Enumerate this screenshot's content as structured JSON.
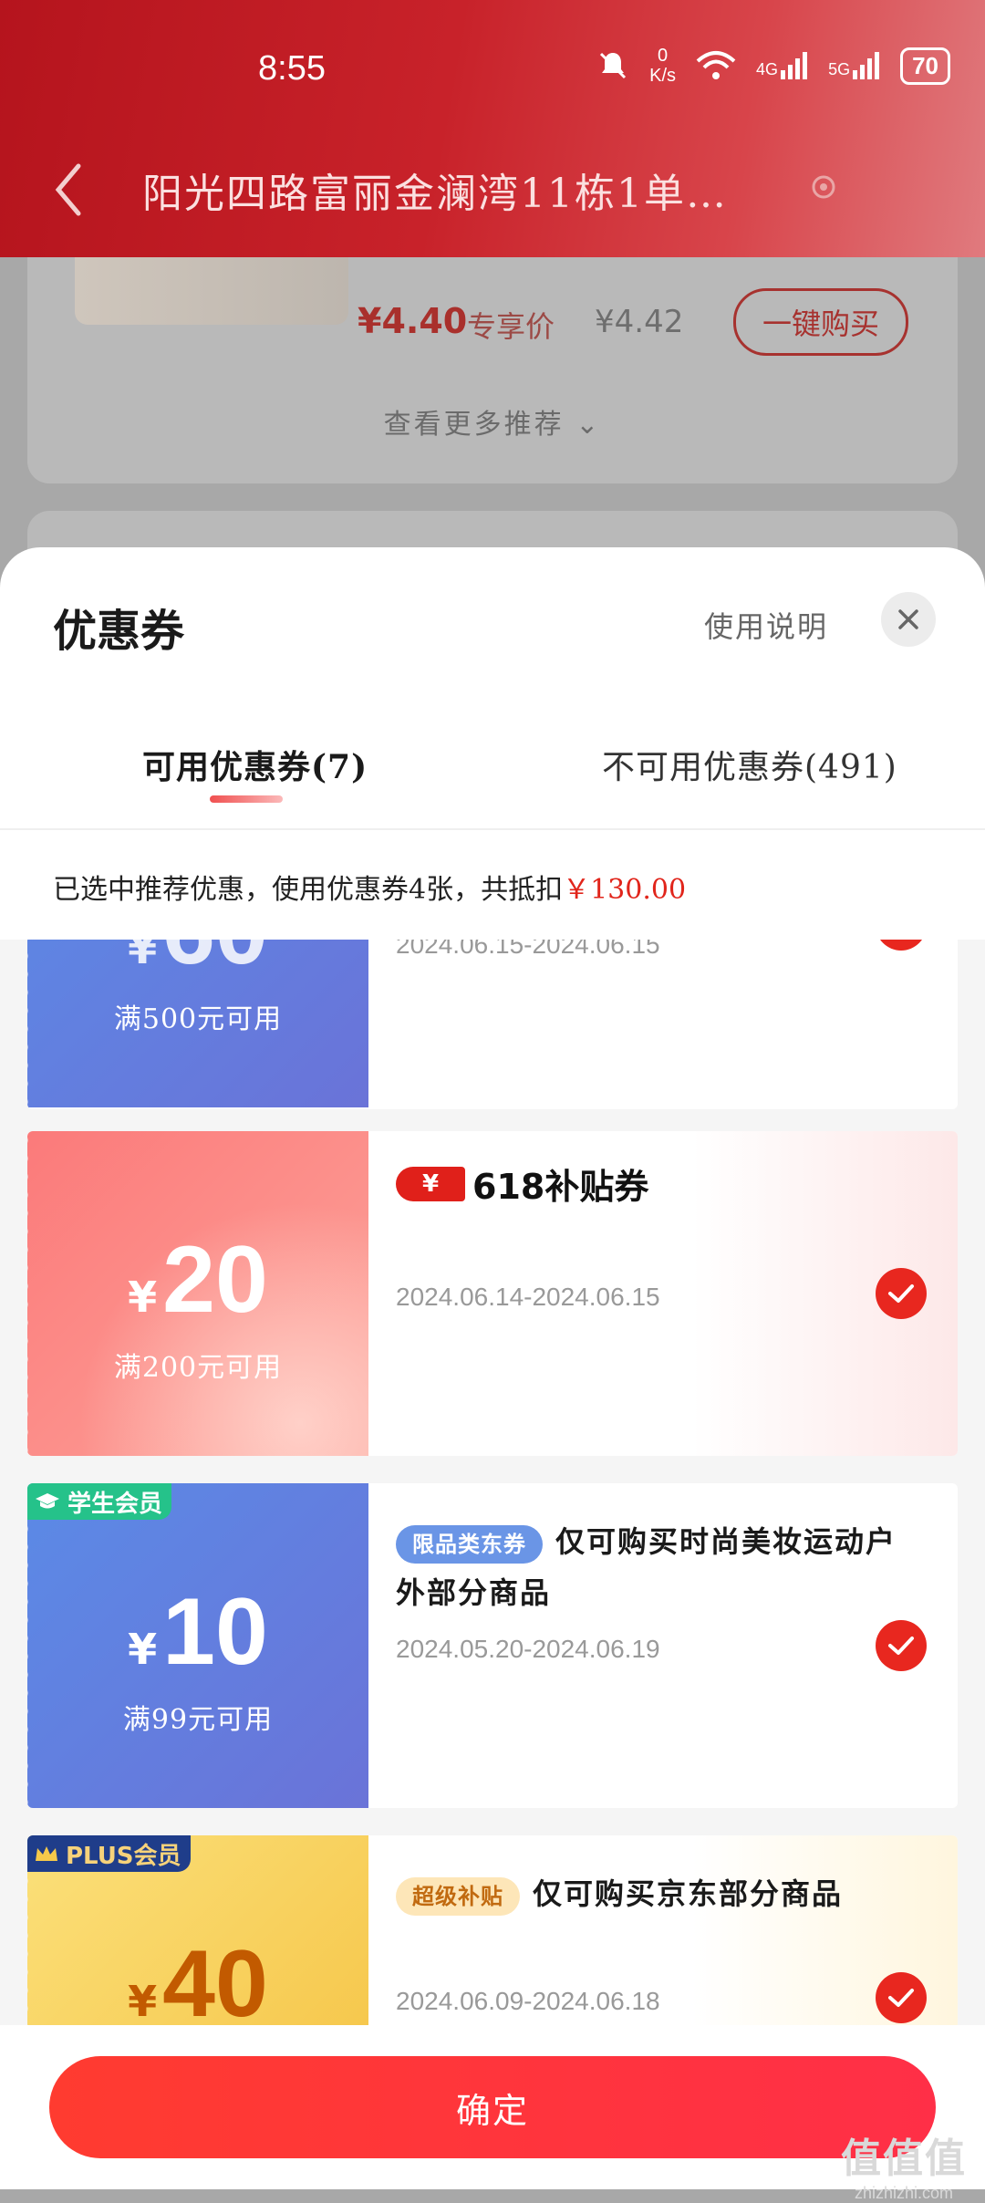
{
  "status_bar": {
    "time": "8:55",
    "net_speed_value": "0",
    "net_speed_unit": "K/s",
    "sig1": "4G",
    "sig2": "5G",
    "battery": "70"
  },
  "header": {
    "address": "阳光四路富丽金澜湾11栋1单…"
  },
  "background_product": {
    "price": "¥4.40",
    "price_tag": "专享价",
    "original_price": "¥4.42",
    "buy_button": "一键购买",
    "more_link": "查看更多推荐"
  },
  "sheet": {
    "title": "优惠券",
    "help_link": "使用说明",
    "tabs": [
      {
        "label": "可用优惠券(7)",
        "active": true
      },
      {
        "label": "不可用优惠券(491)",
        "active": false
      }
    ],
    "summary_prefix": "已选中推荐优惠，使用优惠券4张，共抵扣",
    "summary_amount": "￥130.00"
  },
  "coupons": [
    {
      "currency": "¥",
      "amount": "",
      "condition": "满500元可用",
      "validity": "2024.06.15-2024.06.15",
      "selected": true
    },
    {
      "currency": "¥",
      "amount": "20",
      "condition": "满200元可用",
      "subsidy_mark": "¥",
      "subsidy_title": "618补贴券",
      "validity": "2024.06.14-2024.06.15",
      "selected": true
    },
    {
      "badge": "学生会员",
      "currency": "¥",
      "amount": "10",
      "condition": "满99元可用",
      "tag": "限品类东券",
      "description": "仅可购买时尚美妆运动户外部分商品",
      "validity": "2024.05.20-2024.06.19",
      "selected": true
    },
    {
      "badge": "PLUS会员",
      "currency": "¥",
      "amount": "40",
      "tag": "超级补贴",
      "description": "仅可购买京东部分商品",
      "validity": "2024.06.09-2024.06.18",
      "selected": true
    }
  ],
  "confirm_button": "确定",
  "watermark": {
    "text": "值值值",
    "url": "zhizhizhi.com"
  },
  "colors": {
    "accent": "#e1251b",
    "header": "#c8222a",
    "blue_coupon": "#5b7fe0",
    "pink_coupon": "#fb8a8a",
    "gold_coupon": "#f7c64a"
  }
}
